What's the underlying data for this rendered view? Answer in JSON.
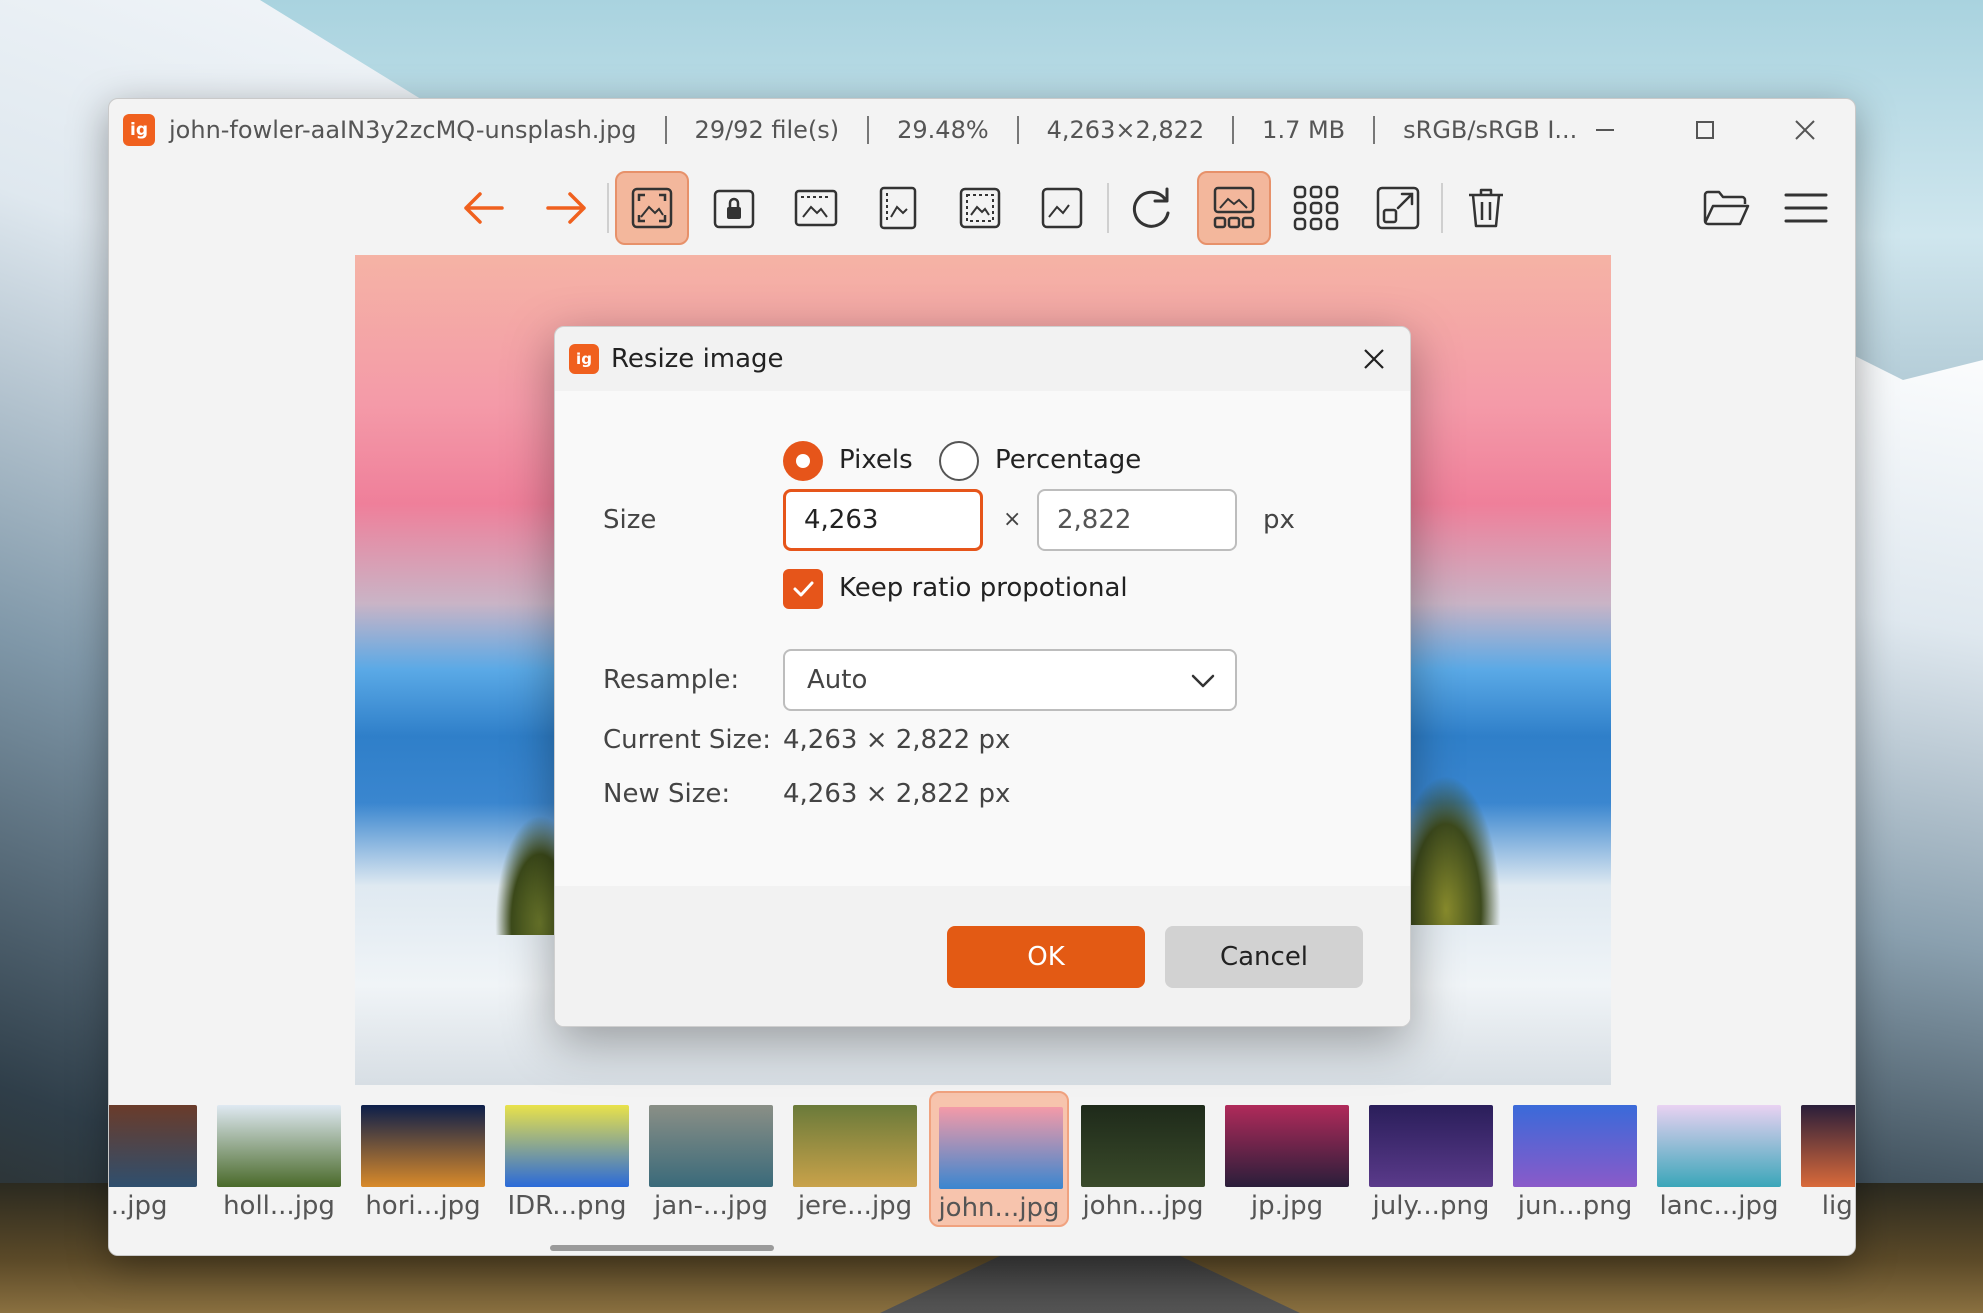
{
  "window": {
    "filename": "john-fowler-aaIN3y2zcMQ-unsplash.jpg",
    "file_count": "29/92 file(s)",
    "zoom": "29.48%",
    "dimensions": "4,263×2,822",
    "filesize": "1.7 MB",
    "color_profile": "sRGB/sRGB I...",
    "logo_text": "ig"
  },
  "toolbar": {
    "icons": [
      "arrow-left-icon",
      "arrow-right-icon",
      "auto-zoom-icon",
      "lock-zoom-icon",
      "scale-to-width-icon",
      "scale-to-height-icon",
      "scale-to-fit-icon",
      "actual-size-icon",
      "refresh-icon",
      "gallery-icon",
      "thumbnail-grid-icon",
      "open-external-icon",
      "delete-icon",
      "open-folder-icon",
      "menu-icon"
    ],
    "accent": "#f0601e"
  },
  "dialog": {
    "title": "Resize image",
    "logo_text": "ig",
    "mode_pixels": "Pixels",
    "mode_percentage": "Percentage",
    "size_label": "Size",
    "width_value": "4,263",
    "height_value": "2,822",
    "times": "×",
    "unit": "px",
    "keep_ratio": "Keep ratio propotional",
    "resample_label": "Resample:",
    "resample_value": "Auto",
    "current_size_label": "Current Size:",
    "current_size_value": "4,263 × 2,822 px",
    "new_size_label": "New Size:",
    "new_size_value": "4,263 × 2,822 px",
    "ok": "OK",
    "cancel": "Cancel"
  },
  "filmstrip": [
    {
      "label": "...jpg",
      "colors": [
        "#6a3b2a",
        "#2f4f6e"
      ]
    },
    {
      "label": "holl...jpg",
      "colors": [
        "#dfe9f2",
        "#4a6a2a"
      ]
    },
    {
      "label": "hori...jpg",
      "colors": [
        "#0c1e4a",
        "#d98a2a"
      ]
    },
    {
      "label": "IDR...png",
      "colors": [
        "#e9e24a",
        "#2a6ad9"
      ]
    },
    {
      "label": "jan-...jpg",
      "colors": [
        "#8a8f86",
        "#3a6a7a"
      ]
    },
    {
      "label": "jere...jpg",
      "colors": [
        "#6a7a3a",
        "#c9a24a"
      ]
    },
    {
      "label": "john...jpg",
      "colors": [
        "#f49aa8",
        "#3a86cf"
      ]
    },
    {
      "label": "john...jpg",
      "colors": [
        "#1e2a1a",
        "#3a4a2a"
      ]
    },
    {
      "label": "jp.jpg",
      "colors": [
        "#b02a5a",
        "#2a1e3a"
      ]
    },
    {
      "label": "july...png",
      "colors": [
        "#2a1e5a",
        "#5a3a8a"
      ]
    },
    {
      "label": "jun...png",
      "colors": [
        "#3a6ad9",
        "#8a5ac9"
      ]
    },
    {
      "label": "lanc...jpg",
      "colors": [
        "#e9d2f2",
        "#3aa6b9"
      ]
    },
    {
      "label": "light...",
      "colors": [
        "#2a1e3a",
        "#d96a3a"
      ]
    }
  ]
}
